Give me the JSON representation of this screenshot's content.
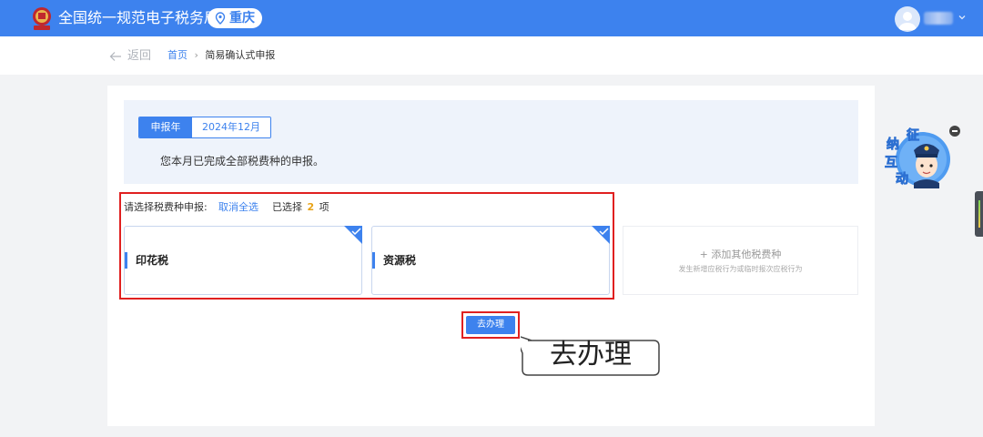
{
  "header": {
    "title": "全国统一规范电子税务局",
    "region": "重庆"
  },
  "nav": {
    "back_label": "返回",
    "breadcrumb": {
      "home": "首页",
      "separator": "›",
      "current": "简易确认式申报"
    }
  },
  "period": {
    "label": "申报年月",
    "value": "2024年12月"
  },
  "info_message": "您本月已完成全部税费种的申报。",
  "selection": {
    "prompt": "请选择税费种申报:",
    "cancel_all": "取消全选",
    "selected_prefix": "已选择",
    "selected_count": "2",
    "selected_suffix": "项"
  },
  "tax_items": [
    {
      "name": "印花税",
      "selected": true
    },
    {
      "name": "资源税",
      "selected": true
    }
  ],
  "add_tax": {
    "title": "+ 添加其他税费种",
    "subtitle": "发生新增应税行为或临时报次应税行为"
  },
  "action": {
    "go_label": "去办理",
    "callout_label": "去办理"
  },
  "assistant": {
    "chars": [
      "征",
      "纳",
      "互",
      "动"
    ]
  },
  "colors": {
    "brand": "#3d82ee",
    "highlight": "#e02020",
    "count": "#e8a317"
  }
}
